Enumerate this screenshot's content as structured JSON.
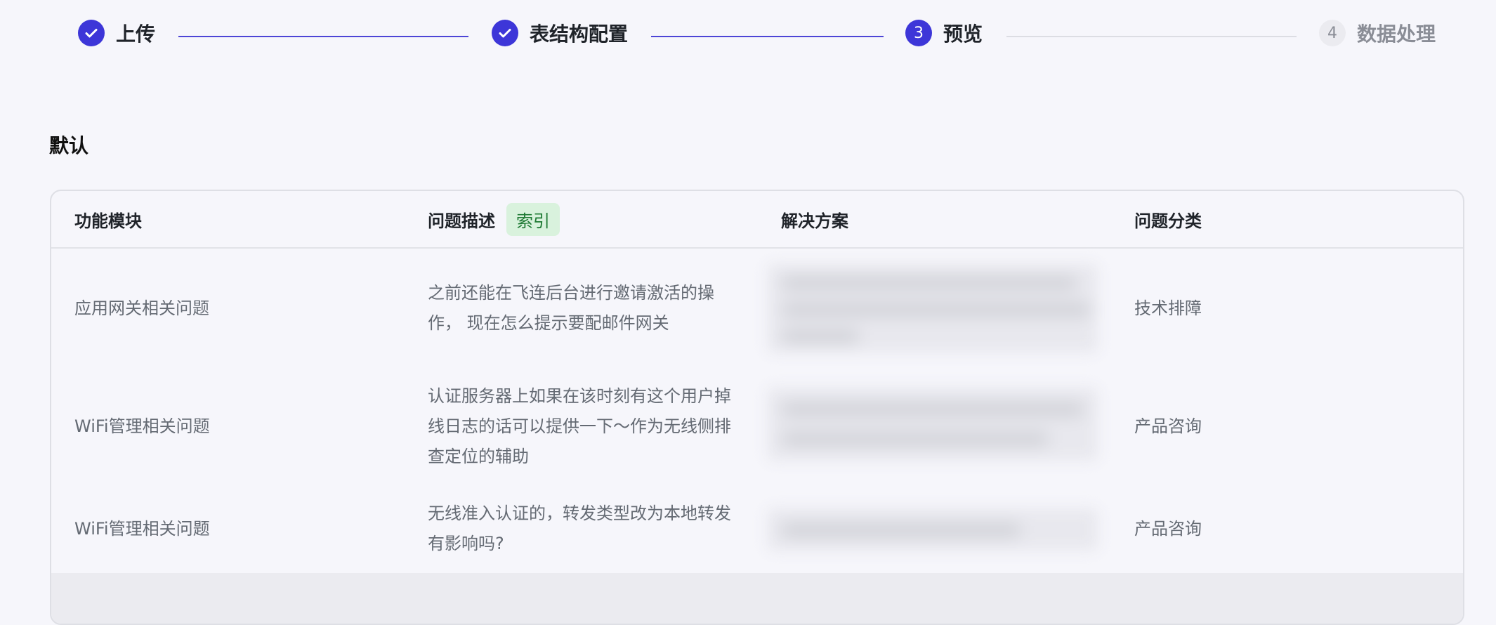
{
  "stepper": {
    "steps": [
      {
        "number": "",
        "label": "上传",
        "state": "done"
      },
      {
        "number": "",
        "label": "表结构配置",
        "state": "done"
      },
      {
        "number": "3",
        "label": "预览",
        "state": "active"
      },
      {
        "number": "4",
        "label": "数据处理",
        "state": "pending"
      }
    ],
    "accent": "#3d36d8"
  },
  "section": {
    "title": "默认"
  },
  "table": {
    "columns": [
      {
        "label": "功能模块"
      },
      {
        "label": "问题描述",
        "badge": "索引"
      },
      {
        "label": "解决方案"
      },
      {
        "label": "问题分类"
      }
    ],
    "rows": [
      {
        "module": "应用网关相关问题",
        "description": "之前还能在飞连后台进行邀请激活的操作， 现在怎么提示要配邮件网关",
        "solution": "",
        "category": "技术排障"
      },
      {
        "module": "WiFi管理相关问题",
        "description": "认证服务器上如果在该时刻有这个用户掉线日志的话可以提供一下～作为无线侧排查定位的辅助",
        "solution": "",
        "category": "产品咨询"
      },
      {
        "module": "WiFi管理相关问题",
        "description": "无线准入认证的，转发类型改为本地转发有影响吗?",
        "solution": "",
        "category": "产品咨询"
      }
    ]
  }
}
